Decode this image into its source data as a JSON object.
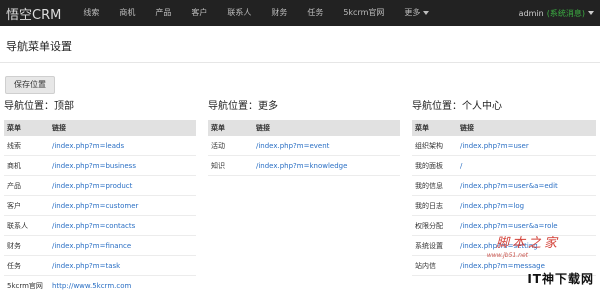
{
  "navbar": {
    "brand": "悟空CRM",
    "items": [
      "线索",
      "商机",
      "产品",
      "客户",
      "联系人",
      "财务",
      "任务",
      "5kcrm官网",
      "更多"
    ],
    "user": "admin",
    "user_note": "(系统消息)"
  },
  "page": {
    "title": "导航菜单设置",
    "save_label": "保存位置"
  },
  "panels": [
    {
      "title": "导航位置：顶部",
      "col_name": "菜单",
      "col_link": "链接",
      "rows": [
        {
          "name": "线索",
          "link": "/index.php?m=leads"
        },
        {
          "name": "商机",
          "link": "/index.php?m=business"
        },
        {
          "name": "产品",
          "link": "/index.php?m=product"
        },
        {
          "name": "客户",
          "link": "/index.php?m=customer"
        },
        {
          "name": "联系人",
          "link": "/index.php?m=contacts"
        },
        {
          "name": "财务",
          "link": "/index.php?m=finance"
        },
        {
          "name": "任务",
          "link": "/index.php?m=task"
        },
        {
          "name": "5kcrm官网",
          "link": "http://www.5kcrm.com"
        }
      ]
    },
    {
      "title": "导航位置：更多",
      "col_name": "菜单",
      "col_link": "链接",
      "rows": [
        {
          "name": "活动",
          "link": "/index.php?m=event"
        },
        {
          "name": "知识",
          "link": "/index.php?m=knowledge"
        }
      ]
    },
    {
      "title": "导航位置：个人中心",
      "col_name": "菜单",
      "col_link": "链接",
      "rows": [
        {
          "name": "组织架构",
          "link": "/index.php?m=user"
        },
        {
          "name": "我的面板",
          "link": "/"
        },
        {
          "name": "我的信息",
          "link": "/index.php?m=user&a=edit"
        },
        {
          "name": "我的日志",
          "link": "/index.php?m=log"
        },
        {
          "name": "权限分配",
          "link": "/index.php?m=user&a=role"
        },
        {
          "name": "系统设置",
          "link": "/index.php?m=setting"
        },
        {
          "name": "站内信",
          "link": "/index.php?m=message"
        }
      ]
    }
  ],
  "watermark": {
    "big": "脚本之家",
    "small": "www.jb51.net",
    "corner": "IT神下载网"
  }
}
